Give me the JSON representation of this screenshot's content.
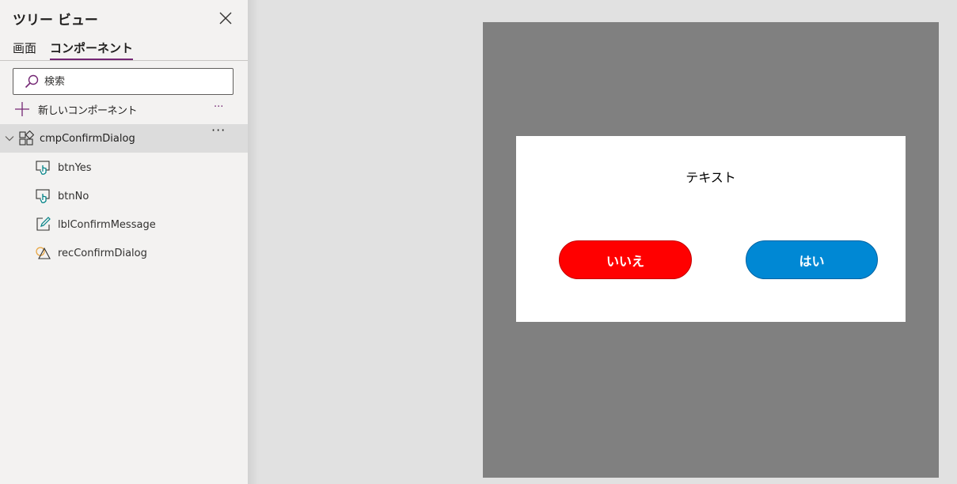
{
  "tree_view": {
    "title": "ツリー ビュー",
    "tabs": [
      {
        "label": "画面",
        "active": false
      },
      {
        "label": "コンポーネント",
        "active": true
      }
    ],
    "search": {
      "placeholder": "検索",
      "value": ""
    },
    "new_component": {
      "label": "新しいコンポーネント",
      "more": "···"
    },
    "root": {
      "label": "cmpConfirmDialog",
      "icon": "component-icon",
      "more": "···",
      "children": [
        {
          "label": "btnYes",
          "icon": "button-icon"
        },
        {
          "label": "btnNo",
          "icon": "button-icon"
        },
        {
          "label": "lblConfirmMessage",
          "icon": "label-edit-icon"
        },
        {
          "label": "recConfirmDialog",
          "icon": "shapes-icon"
        }
      ]
    }
  },
  "canvas": {
    "dialog_text": "テキスト",
    "no_button": {
      "label": "いいえ",
      "color": "#ff0000"
    },
    "yes_button": {
      "label": "はい",
      "color": "#0088d4"
    }
  },
  "colors": {
    "accent": "#742774",
    "panel_bg": "#f3f2f1",
    "canvas_bg": "#e1e1e1",
    "screen_bg": "#808080",
    "icon_teal": "#038387"
  }
}
